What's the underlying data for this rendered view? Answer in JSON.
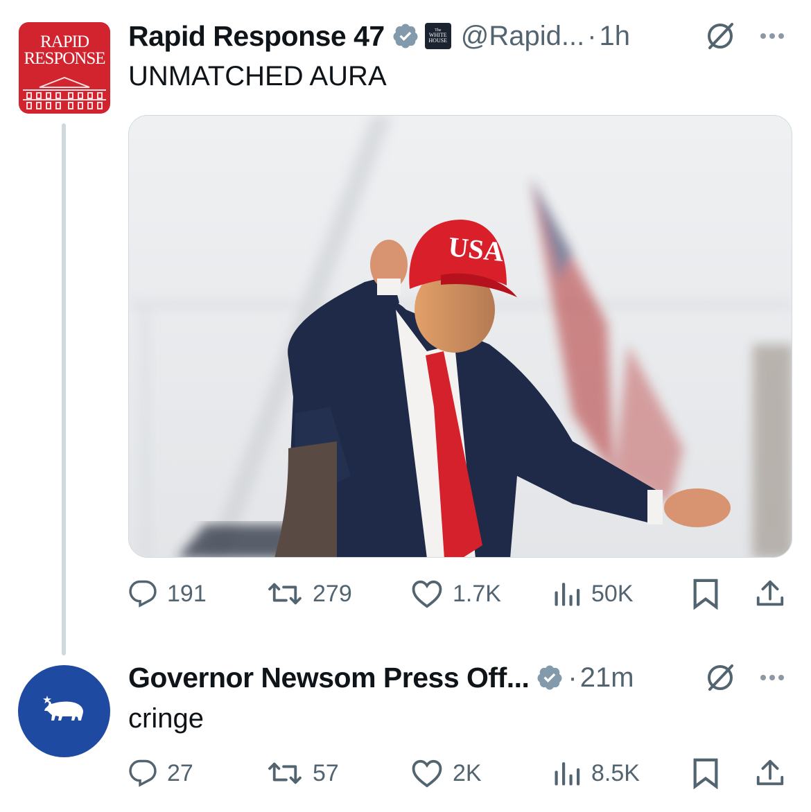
{
  "posts": [
    {
      "author": "Rapid Response 47",
      "handle": "@Rapid...",
      "time": "1h",
      "badge_text": [
        "The",
        "WHITE",
        "HOUSE"
      ],
      "avatar_text": [
        "RAPID",
        "RESPONSE"
      ],
      "text": "UNMATCHED AURA",
      "image_caption_on_cap": "USA",
      "replies": "191",
      "reposts": "279",
      "likes": "1.7K",
      "views": "50K"
    },
    {
      "author": "Governor Newsom Press Off...",
      "time": "21m",
      "text": "cringe",
      "replies": "27",
      "reposts": "57",
      "likes": "2K",
      "views": "8.5K"
    }
  ],
  "separator": "·",
  "colors": {
    "rr_red": "#d1242f",
    "gov_blue": "#1f4aa1",
    "verified_gray": "#829aab",
    "meta_gray": "#536471",
    "thread_line": "#cfd9de"
  },
  "icons": [
    "verified-badge-icon",
    "grok-icon",
    "more-icon",
    "reply-icon",
    "repost-icon",
    "like-icon",
    "views-icon",
    "bookmark-icon",
    "share-icon",
    "bear-icon",
    "star-icon"
  ]
}
